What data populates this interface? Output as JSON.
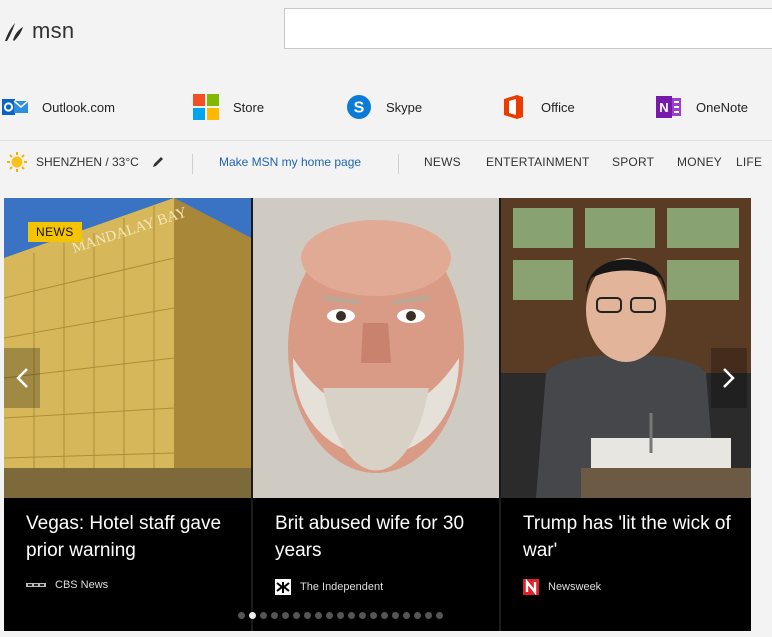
{
  "header": {
    "brand": "msn",
    "search_value": ""
  },
  "apps": [
    {
      "label": "Outlook.com",
      "icon": "outlook-icon"
    },
    {
      "label": "Store",
      "icon": "store-icon"
    },
    {
      "label": "Skype",
      "icon": "skype-icon"
    },
    {
      "label": "Office",
      "icon": "office-icon"
    },
    {
      "label": "OneNote",
      "icon": "onenote-icon"
    }
  ],
  "nav": {
    "weather": "SHENZHEN / 33°C",
    "homepage_link": "Make MSN my home page",
    "categories": [
      "NEWS",
      "ENTERTAINMENT",
      "SPORT",
      "MONEY",
      "LIFE"
    ]
  },
  "carousel": {
    "badge": "NEWS",
    "slides": [
      {
        "title": "Vegas: Hotel staff gave prior warning",
        "source": "CBS News",
        "source_icon": "cbs-news-logo-icon"
      },
      {
        "title": "Brit abused wife for 30 years",
        "source": "The Independent",
        "source_icon": "the-independent-logo-icon"
      },
      {
        "title": "Trump has 'lit the wick of war'",
        "source": "Newsweek",
        "source_icon": "newsweek-logo-icon"
      }
    ],
    "dot_count": 19,
    "active_dot": 2
  },
  "colors": {
    "background": "#f3f3f3",
    "link_blue": "#1e63b8",
    "news_badge": "#f5c400"
  }
}
